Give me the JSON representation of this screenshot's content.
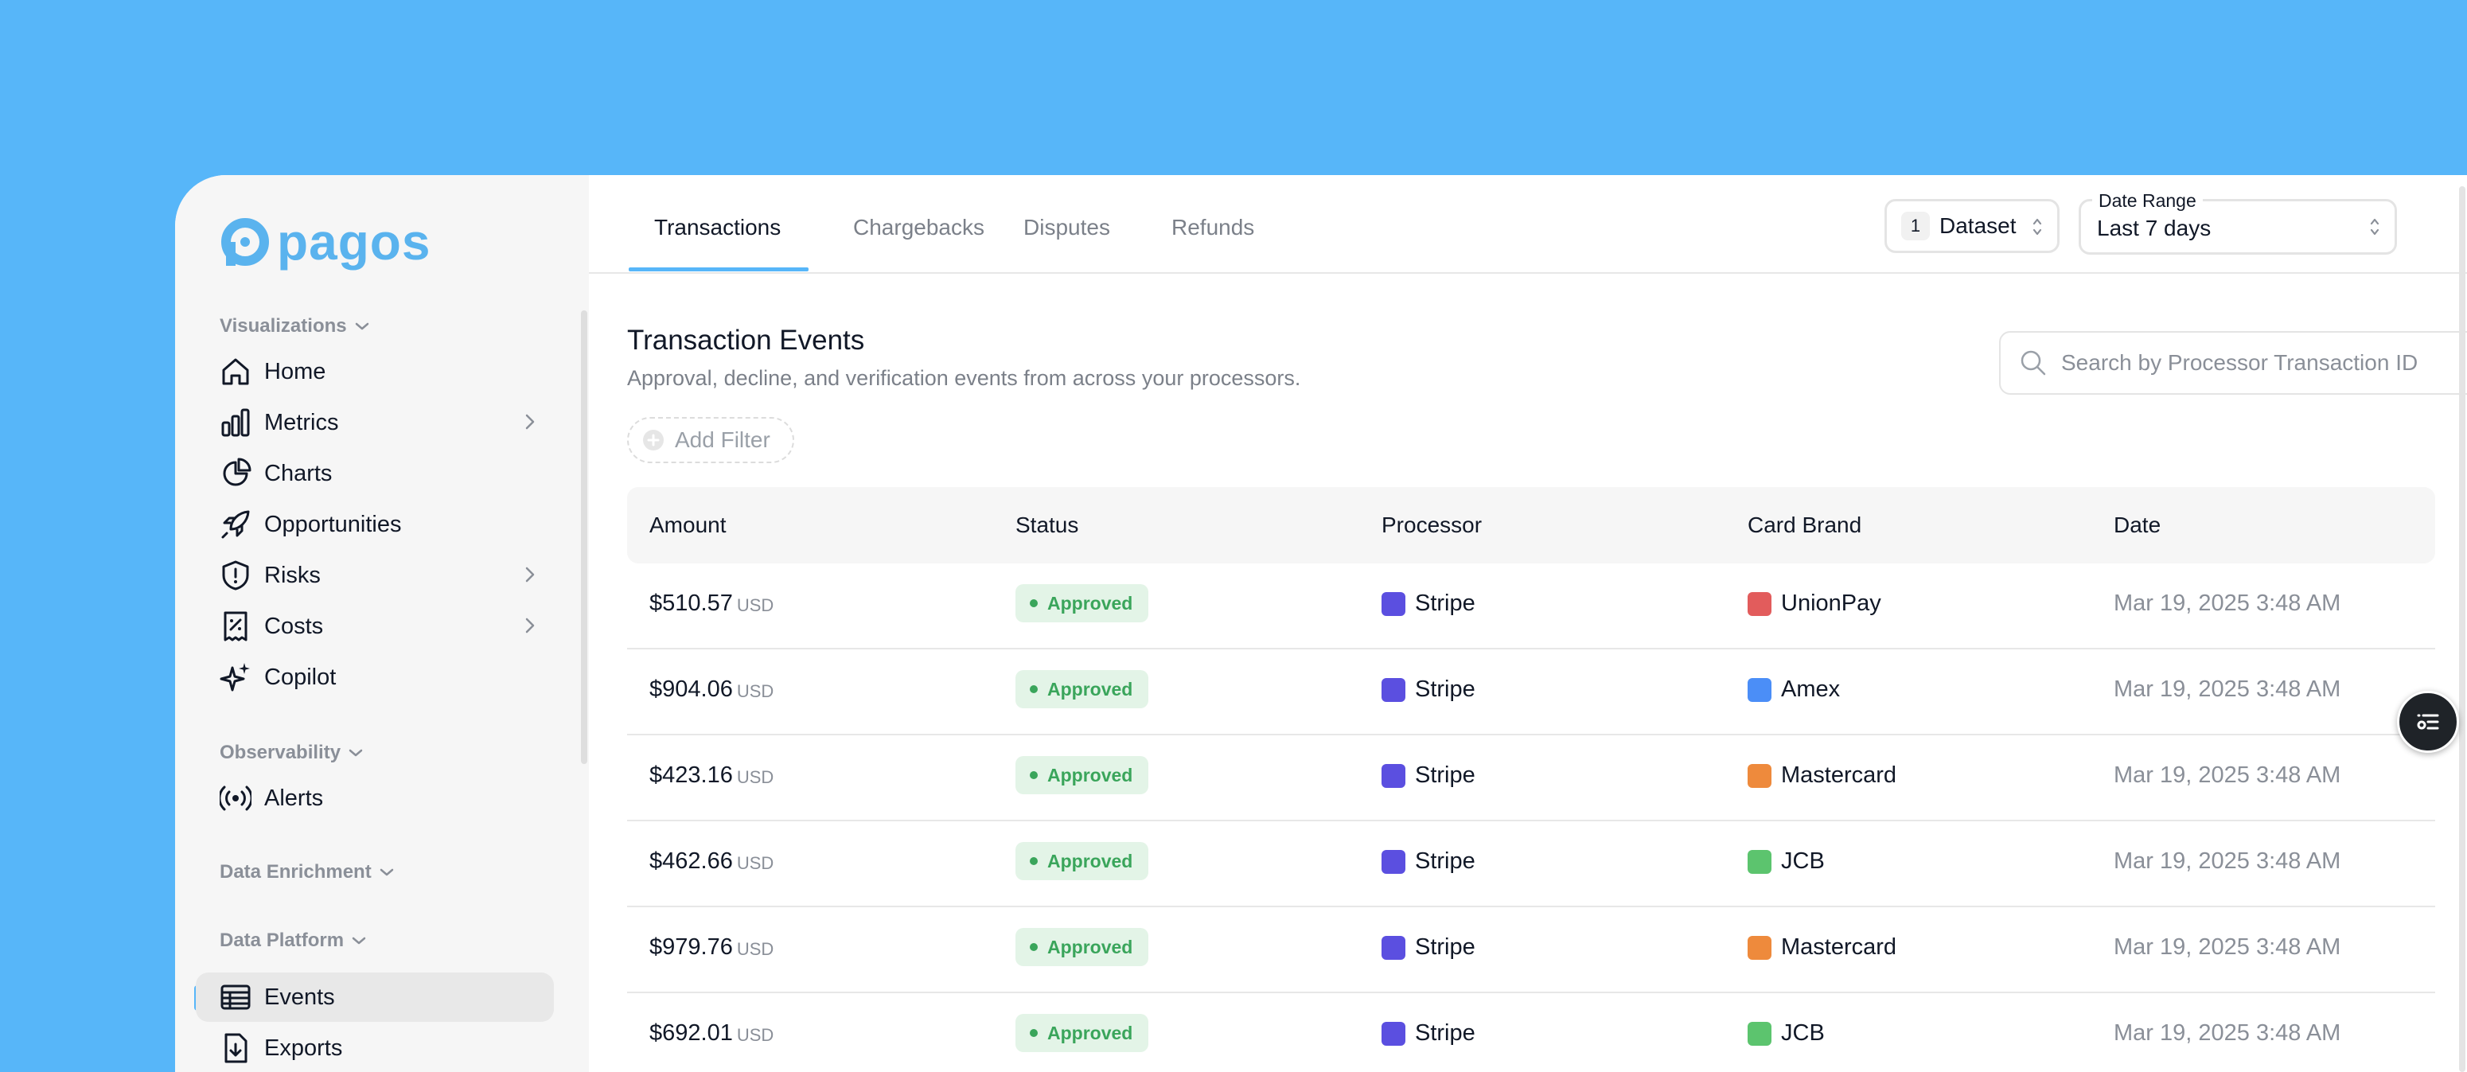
{
  "brand": {
    "name": "pagos",
    "accent": "#57b6f9"
  },
  "sidebar": {
    "sections": [
      {
        "title": "Visualizations",
        "items": [
          {
            "label": "Home",
            "icon": "home-icon"
          },
          {
            "label": "Metrics",
            "icon": "bar-chart-icon",
            "has_submenu": true
          },
          {
            "label": "Charts",
            "icon": "pie-chart-icon"
          },
          {
            "label": "Opportunities",
            "icon": "rocket-icon"
          },
          {
            "label": "Risks",
            "icon": "shield-icon",
            "has_submenu": true
          },
          {
            "label": "Costs",
            "icon": "receipt-icon",
            "has_submenu": true
          },
          {
            "label": "Copilot",
            "icon": "sparkles-icon"
          }
        ]
      },
      {
        "title": "Observability",
        "items": [
          {
            "label": "Alerts",
            "icon": "broadcast-icon"
          }
        ]
      },
      {
        "title": "Data Enrichment",
        "items": []
      },
      {
        "title": "Data Platform",
        "items": [
          {
            "label": "Events",
            "icon": "table-icon",
            "active": true
          },
          {
            "label": "Exports",
            "icon": "download-file-icon"
          }
        ]
      }
    ]
  },
  "tabs": [
    "Transactions",
    "Chargebacks",
    "Disputes",
    "Refunds"
  ],
  "active_tab": "Transactions",
  "dataset": {
    "count": "1",
    "label": "Dataset"
  },
  "date_range": {
    "label": "Date Range",
    "value": "Last 7 days"
  },
  "page": {
    "title": "Transaction Events",
    "subtitle": "Approval, decline, and verification events from across your processors."
  },
  "search": {
    "placeholder": "Search by Processor Transaction ID",
    "value": ""
  },
  "add_filter_label": "Add Filter",
  "table": {
    "columns": [
      "Amount",
      "Status",
      "Processor",
      "Card Brand",
      "Date"
    ],
    "rows": [
      {
        "amount": "$510.57",
        "currency": "USD",
        "status": "Approved",
        "processor": "Stripe",
        "processor_color": "#5b4fe0",
        "card_brand": "UnionPay",
        "card_color": "#e25c5c",
        "date": "Mar 19, 2025 3:48 AM"
      },
      {
        "amount": "$904.06",
        "currency": "USD",
        "status": "Approved",
        "processor": "Stripe",
        "processor_color": "#5b4fe0",
        "card_brand": "Amex",
        "card_color": "#4b8ef7",
        "date": "Mar 19, 2025 3:48 AM"
      },
      {
        "amount": "$423.16",
        "currency": "USD",
        "status": "Approved",
        "processor": "Stripe",
        "processor_color": "#5b4fe0",
        "card_brand": "Mastercard",
        "card_color": "#ee8a3c",
        "date": "Mar 19, 2025 3:48 AM"
      },
      {
        "amount": "$462.66",
        "currency": "USD",
        "status": "Approved",
        "processor": "Stripe",
        "processor_color": "#5b4fe0",
        "card_brand": "JCB",
        "card_color": "#5cc46e",
        "date": "Mar 19, 2025 3:48 AM"
      },
      {
        "amount": "$979.76",
        "currency": "USD",
        "status": "Approved",
        "processor": "Stripe",
        "processor_color": "#5b4fe0",
        "card_brand": "Mastercard",
        "card_color": "#ee8a3c",
        "date": "Mar 19, 2025 3:48 AM"
      },
      {
        "amount": "$692.01",
        "currency": "USD",
        "status": "Approved",
        "processor": "Stripe",
        "processor_color": "#5b4fe0",
        "card_brand": "JCB",
        "card_color": "#5cc46e",
        "date": "Mar 19, 2025 3:48 AM"
      }
    ]
  },
  "status_color": "#3aa55b",
  "floating_button": {
    "icon": "filter-list-icon"
  }
}
